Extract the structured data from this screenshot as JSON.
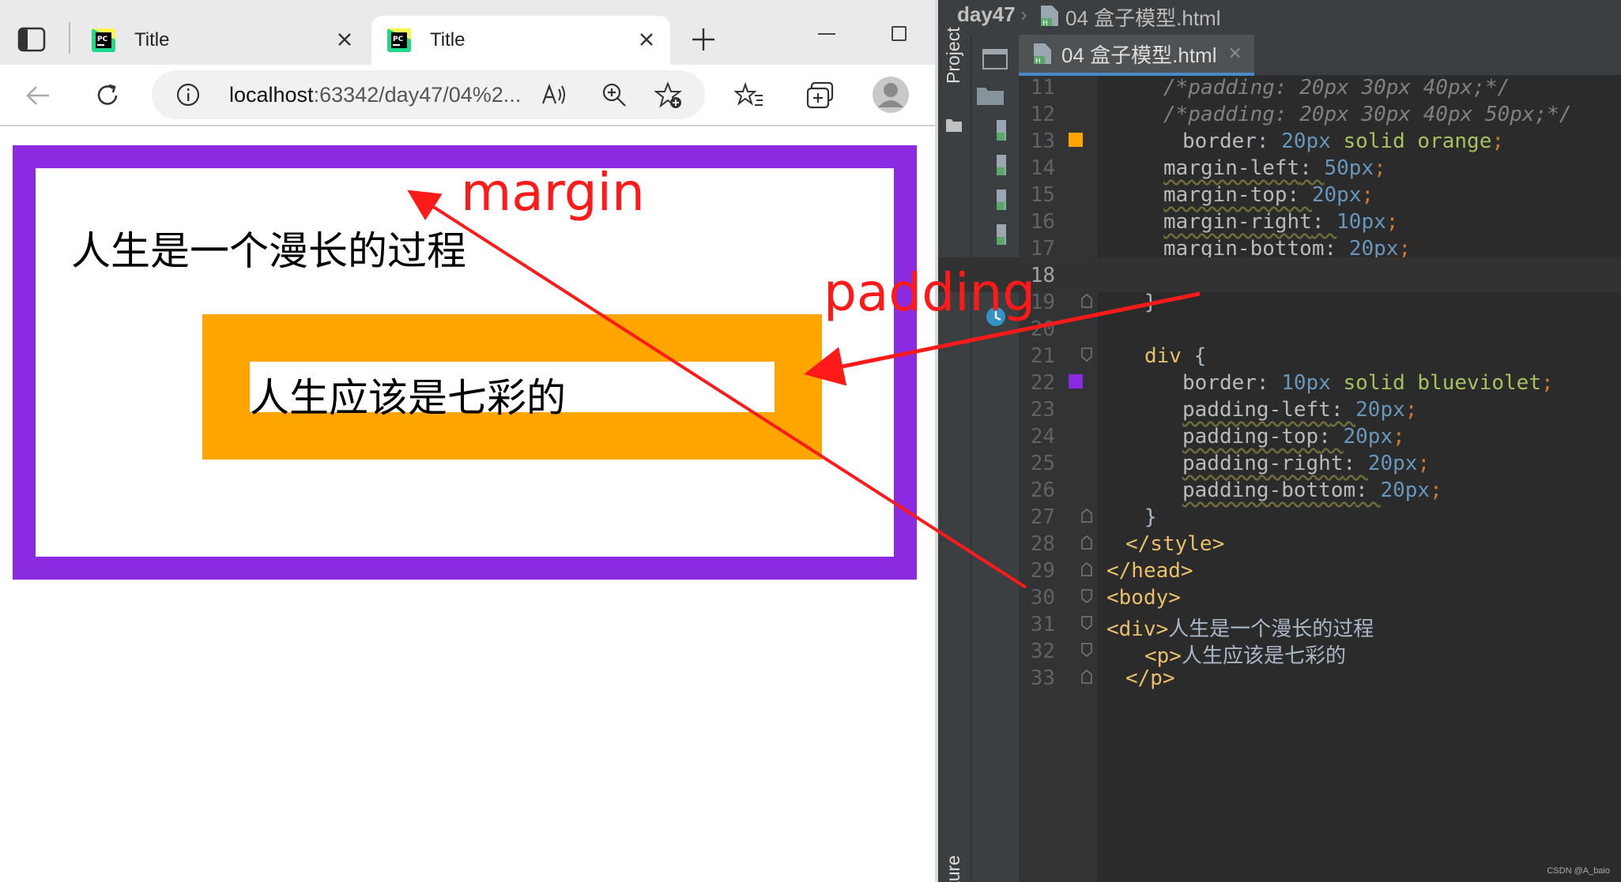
{
  "browser": {
    "tabs": [
      {
        "title": "Title",
        "active": false
      },
      {
        "title": "Title",
        "active": true
      }
    ],
    "url_host": "localhost",
    "url_rest": ":63342/day47/04%2...",
    "page": {
      "outer_text": "人生是一个漫长的过程",
      "inner_text": "人生应该是七彩的",
      "outer_border_color": "#8a2be2",
      "inner_bg_color": "#ffa500"
    }
  },
  "ide": {
    "breadcrumb_project": "day47",
    "breadcrumb_file": "04 盒子模型.html",
    "tab_name": "04 盒子模型.html",
    "tool_project": "Project",
    "tool_structure": "tructure",
    "lines": {
      "l11": {
        "num": "11",
        "text": "/*padding: 20px 30px 40px;*/"
      },
      "l12": {
        "num": "12",
        "text": "/*padding: 20px 30px 40px 50px;*/"
      },
      "l13": {
        "num": "13",
        "prop": "border",
        "num_val": "20px",
        "rest": " solid orange",
        "swatch": "#ffa500"
      },
      "l14": {
        "num": "14",
        "prop": "margin-left",
        "num_val": "50px"
      },
      "l15": {
        "num": "15",
        "prop": "margin-top",
        "num_val": "20px"
      },
      "l16": {
        "num": "16",
        "prop": "margin-right",
        "num_val": "10px"
      },
      "l17": {
        "num": "17",
        "prop": "margin-bottom",
        "num_val": "20px"
      },
      "l18": {
        "num": "18"
      },
      "l19": {
        "num": "19",
        "text": "}"
      },
      "l20": {
        "num": "20"
      },
      "l21": {
        "num": "21",
        "selector": "div",
        "brace": " {"
      },
      "l22": {
        "num": "22",
        "prop": "border",
        "num_val": "10px",
        "rest": " solid blueviolet",
        "swatch": "#8a2be2"
      },
      "l23": {
        "num": "23",
        "prop": "padding-left",
        "num_val": "20px"
      },
      "l24": {
        "num": "24",
        "prop": "padding-top",
        "num_val": "20px"
      },
      "l25": {
        "num": "25",
        "prop": "padding-right",
        "num_val": "20px"
      },
      "l26": {
        "num": "26",
        "prop": "padding-bottom",
        "num_val": "20px"
      },
      "l27": {
        "num": "27",
        "text": "}"
      },
      "l28": {
        "num": "28",
        "tag": "</style>"
      },
      "l29": {
        "num": "29",
        "tag": "</head>"
      },
      "l30": {
        "num": "30",
        "tag": "<body>"
      },
      "l31": {
        "num": "31",
        "tag": "<div>",
        "text": "人生是一个漫长的过程"
      },
      "l32": {
        "num": "32",
        "tag": "<p>",
        "text": "人生应该是七彩的"
      },
      "l33": {
        "num": "33",
        "tag": "</p>"
      }
    }
  },
  "annotations": {
    "margin": "margin",
    "padding": "padding",
    "color": "#ff1a1a"
  },
  "watermark": "CSDN @A_baio"
}
